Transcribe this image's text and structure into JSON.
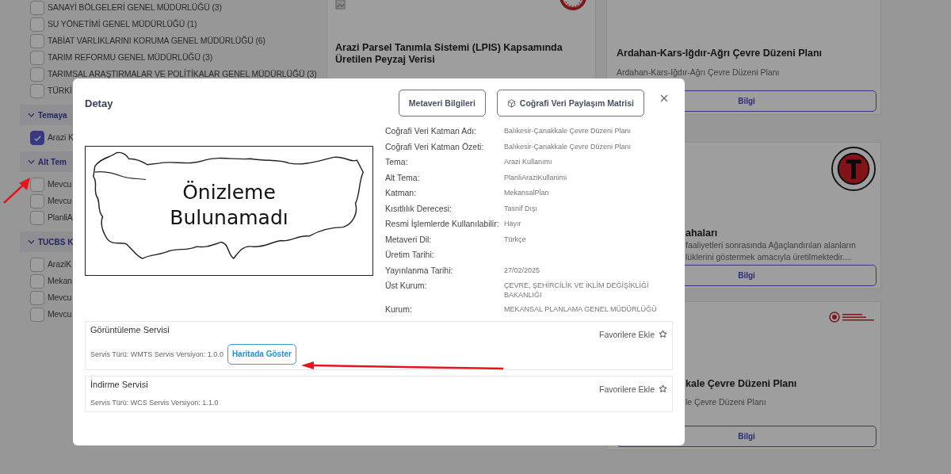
{
  "sidebar": {
    "items": [
      {
        "label": "SANAYİ BÖLGELERİ GENEL MÜDÜRLÜĞÜ (3)",
        "checked": false
      },
      {
        "label": "SU YÖNETİMİ GENEL MÜDÜRLÜĞÜ (1)",
        "checked": false
      },
      {
        "label": "TABİAT VARLIKLARINI KORUMA GENEL MÜDÜRLÜĞÜ (6)",
        "checked": false
      },
      {
        "label": "TARIM REFORMU GENEL MÜDÜRLÜĞÜ (3)",
        "checked": false
      },
      {
        "label": "TARIMSAL ARAŞTIRMALAR VE POLİTİKALAR GENEL MÜDÜRLÜĞÜ (3)",
        "checked": false
      },
      {
        "label": "TÜRKİ",
        "checked": false
      }
    ],
    "sections": [
      {
        "title": "Temaya",
        "items": [
          {
            "label": "Arazi K",
            "checked": true
          }
        ]
      },
      {
        "title": "Alt Tem",
        "items": [
          {
            "label": "Mevcu",
            "checked": false
          },
          {
            "label": "Mevcu",
            "checked": false
          },
          {
            "label": "PlanliA",
            "checked": false
          }
        ]
      },
      {
        "title": "TUCBS K",
        "items": [
          {
            "label": "AraziK",
            "checked": false
          },
          {
            "label": "Mekan",
            "checked": false
          },
          {
            "label": "Mevcu",
            "checked": false
          },
          {
            "label": "Mevcu",
            "checked": false
          }
        ]
      }
    ]
  },
  "cards": {
    "center": [
      {
        "title": "Arazi Parsel Tanımla Sistemi (LPIS) Kapsamında Üretilen Peyzaj Verisi"
      }
    ],
    "right": [
      {
        "title": "Ardahan-Kars-Iğdır-Ağrı Çevre Düzeni Planı",
        "description_lines": [
          "Ardahan-Kars-Iğdır-Ağrı Çevre Düzeni Planı"
        ],
        "button": "Bilgi"
      },
      {
        "title": "ahaları",
        "description_lines": [
          "faaliyetleri sonrasında Ağaçlandırılan alanların",
          "lüklerini göstermek amacıyla üretilmektedir...."
        ],
        "button": "Bilgi"
      },
      {
        "title": "kale Çevre Düzeni Planı",
        "description_lines": [
          "le Çevre Düzeni Planı"
        ],
        "button": "Bilgi"
      }
    ]
  },
  "modal": {
    "title": "Detay",
    "buttons": [
      {
        "label": "Metaveri Bilgileri",
        "icon": false
      },
      {
        "label": "Coğrafi Veri Paylaşım Matrisi",
        "icon": true
      }
    ],
    "preview_text": [
      "Önizleme",
      "Bulunamadı"
    ],
    "fields": [
      {
        "label": "Coğrafi Veri Katman Adı:",
        "value": "Balıkesir-Çanakkale Çevre Düzeni Planı"
      },
      {
        "label": "Coğrafi Veri Katman Özeti:",
        "value": "Balıkesir-Çanakkale Çevre Düzeni Planı"
      },
      {
        "label": "Tema:",
        "value": "Arazi Kullanımı"
      },
      {
        "label": "Alt Tema:",
        "value": "PlanliAraziKullanimi"
      },
      {
        "label": "Katman:",
        "value": "MekansalPlan"
      },
      {
        "label": "Kısıtlılık Derecesi:",
        "value": "Tasnif Dışı"
      },
      {
        "label": "Resmi İşlemlerde Kullanılabilir:",
        "value": "Hayır"
      },
      {
        "label": "Metaveri Dil:",
        "value": "Türkçe"
      },
      {
        "label": "Üretim Tarihi:"
      },
      {
        "label": "Yayınlanma Tarihi:",
        "value": "27/02/2025"
      },
      {
        "label": "Üst Kurum:",
        "value": "ÇEVRE, ŞEHİRCİLİK VE İKLİM DEĞİŞİKLİĞİ BAKANLIĞI"
      },
      {
        "label": "Kurum:",
        "value": "MEKANSAL PLANLAMA GENEL MÜDÜRLÜĞÜ"
      }
    ],
    "services": [
      {
        "title": "Görüntüleme Servisi",
        "info": "Servis Türü: WMTS  Servis Versiyon: 1.0.0",
        "favorite": "Favorilere Ekle",
        "action": "Haritada Göster"
      },
      {
        "title": "İndirme Servisi",
        "info": "Servis Türü: WCS  Servis Versiyon: 1.1.0",
        "favorite": "Favorilere Ekle"
      }
    ]
  }
}
